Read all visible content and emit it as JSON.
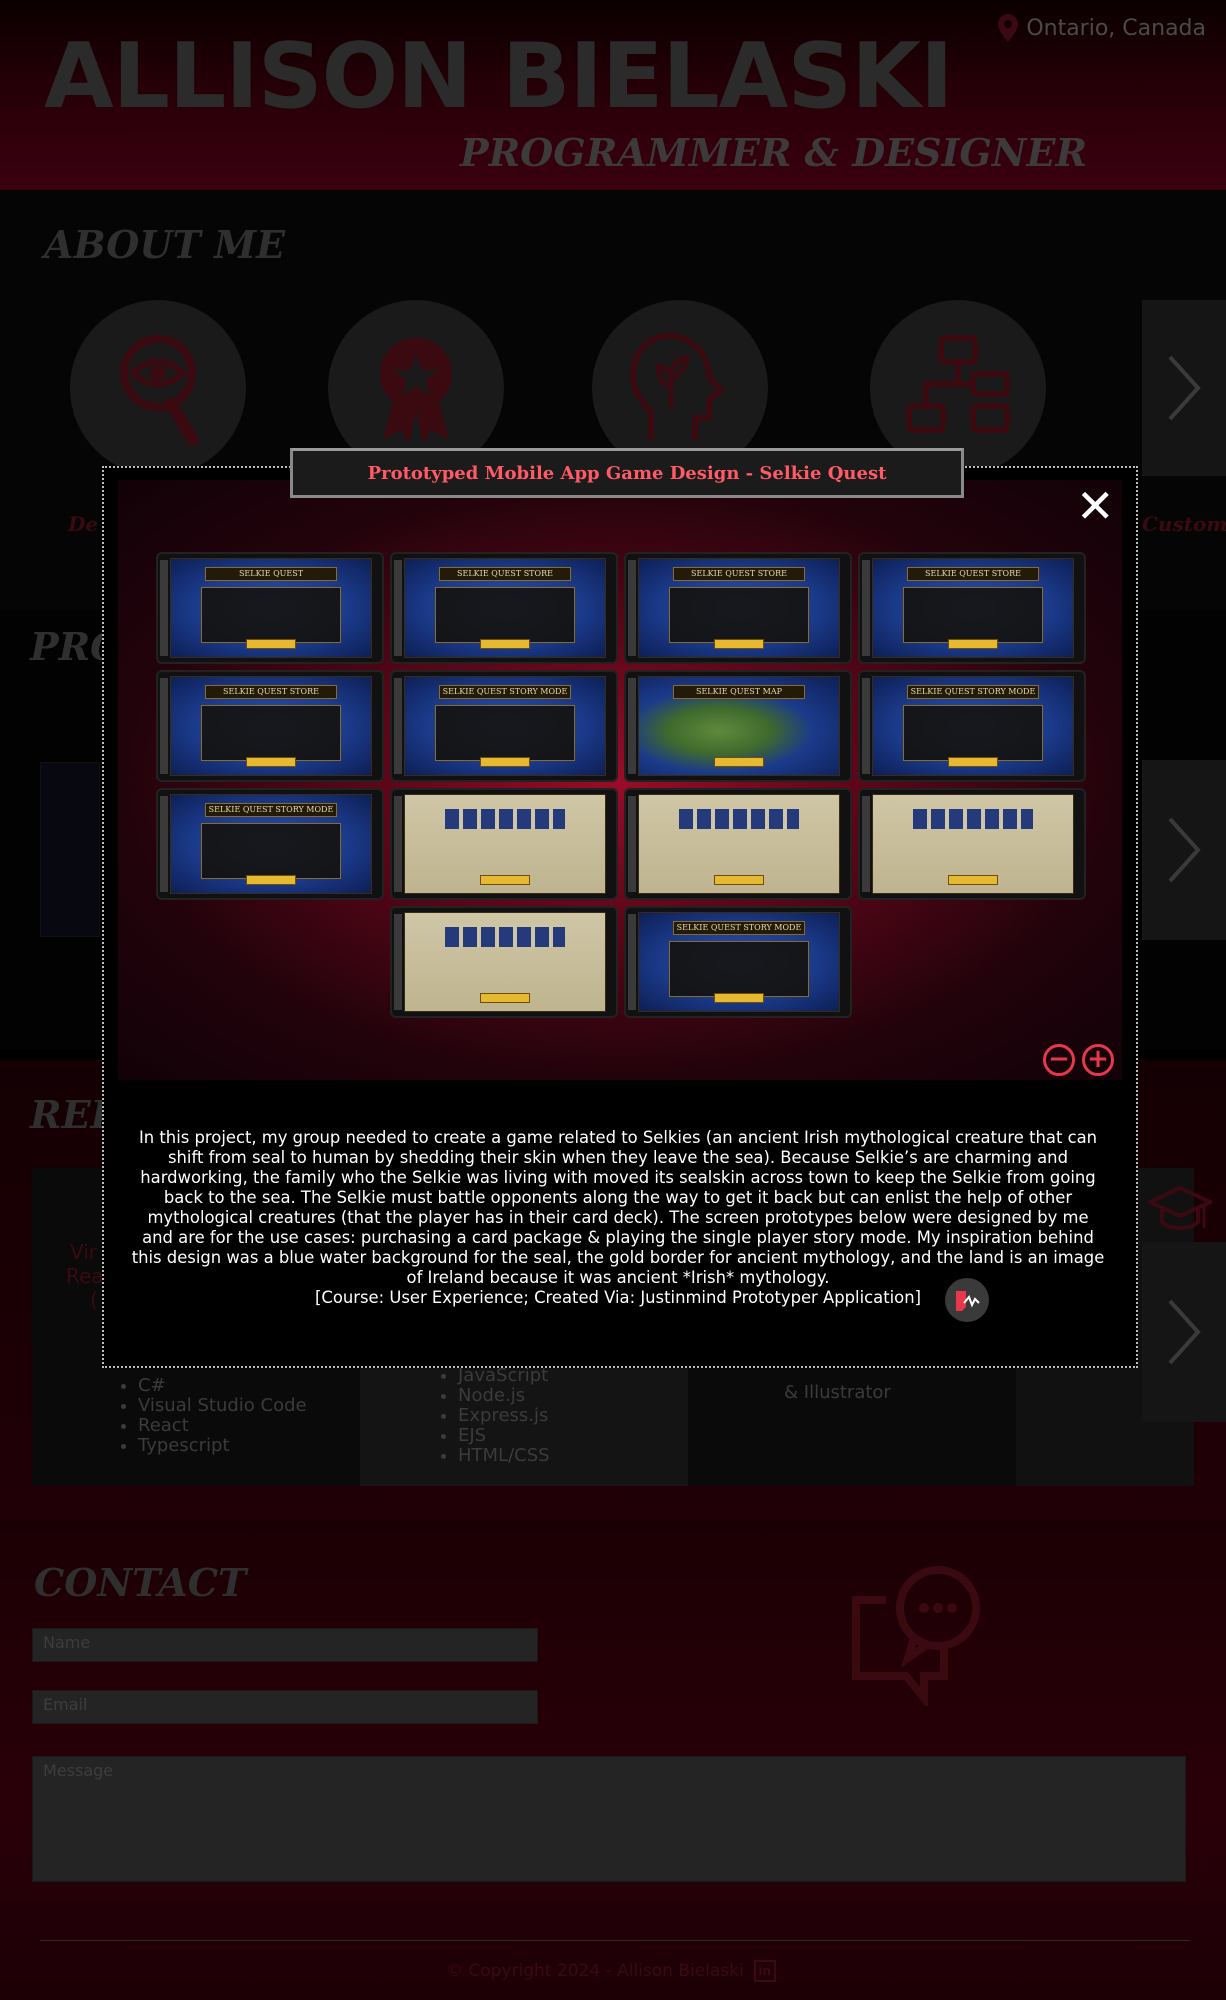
{
  "header": {
    "name": "ALLISON BIELASKI",
    "role": "PROGRAMMER & DESIGNER",
    "location": "Ontario, Canada"
  },
  "about": {
    "title": "ABOUT ME",
    "icons": [
      "eye-magnifier-icon",
      "award-ribbon-icon",
      "head-plant-icon",
      "flowchart-icon"
    ],
    "partial_labels": [
      "De",
      "Custom"
    ]
  },
  "projects": {
    "title_partial": "PRO"
  },
  "related": {
    "title_partial": "REL",
    "col1_partial": [
      "Vir",
      "Rea",
      "("
    ],
    "col1_list": [
      "C#",
      "Visual Studio Code",
      "React",
      "Typescript"
    ],
    "col2_list": [
      "JavaScript",
      "Node.js",
      "Express.js",
      "EJS",
      "HTML/CSS"
    ],
    "col3_text": "& Illustrator"
  },
  "contact": {
    "title": "CONTACT",
    "name_placeholder": "Name",
    "email_placeholder": "Email",
    "message_placeholder": "Message"
  },
  "footer": {
    "copyright": "© Copyright 2024 - Allison Bielaski",
    "linkedin_icon": "linkedin-icon",
    "linkedin_glyph": "in"
  },
  "modal": {
    "title": "Prototyped Mobile App Game Design - Selkie Quest",
    "close_glyph": "✕",
    "zoom_out_glyph": "−",
    "zoom_in_glyph": "+",
    "screens": [
      {
        "header": "SELKIE QUEST",
        "style": "blue"
      },
      {
        "header": "SELKIE QUEST STORE",
        "style": "blue"
      },
      {
        "header": "SELKIE QUEST STORE",
        "style": "blue"
      },
      {
        "header": "SELKIE QUEST STORE",
        "style": "blue"
      },
      {
        "header": "SELKIE QUEST STORE",
        "style": "blue"
      },
      {
        "header": "SELKIE QUEST STORY MODE",
        "style": "blue"
      },
      {
        "header": "SELKIE QUEST MAP",
        "style": "map"
      },
      {
        "header": "SELKIE QUEST STORY MODE",
        "style": "blue"
      },
      {
        "header": "SELKIE QUEST STORY MODE",
        "style": "blue"
      },
      {
        "header": "",
        "style": "parch"
      },
      {
        "header": "",
        "style": "parch"
      },
      {
        "header": "",
        "style": "parch"
      },
      {
        "header": "",
        "style": "parch"
      },
      {
        "header": "SELKIE QUEST STORY MODE",
        "style": "blue"
      }
    ],
    "description": "In this project, my group needed to create a game related to Selkies (an ancient Irish mythological creature that can shift from seal to human by shedding their skin when they leave the sea). Because Selkie’s are charming and hardworking, the family who the Selkie was living with moved its sealskin across town to keep the Selkie from going back to the sea. The Selkie must battle opponents along the way to get it back but can enlist the help of other mythological creatures (that the player has in their card deck). The screen prototypes below were designed by me and are for the use cases: purchasing a card package & playing the single player story mode. My inspiration behind this design was a blue water background for the seal, the gold border for ancient mythology, and the land is an image of Ireland because it was ancient *Irish* mythology.",
    "course": "[Course: User Experience; Created Via: Justinmind Prototyper Application]",
    "app_icon": "justinmind-app-icon"
  }
}
